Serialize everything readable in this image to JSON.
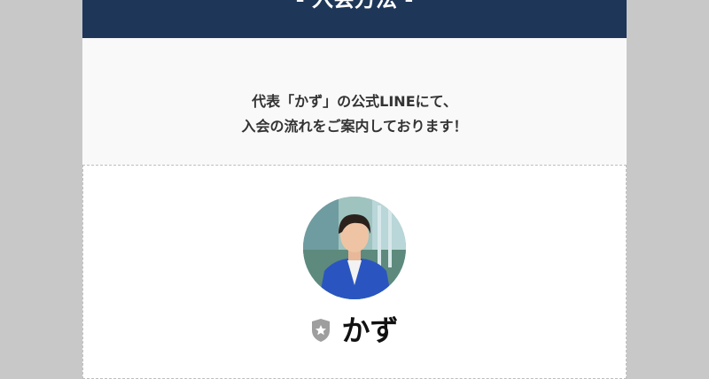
{
  "header": {
    "title": "- 入会方法 -"
  },
  "intro": {
    "line1": "代表「かず」の公式LINEにて、",
    "line2": "入会の流れをご案内しております！"
  },
  "profile": {
    "name": "かず",
    "badge_icon": "shield-star-icon",
    "avatar_icon": "profile-photo"
  },
  "colors": {
    "header_bg": "#1e3759",
    "badge": "#9e9e9e"
  }
}
